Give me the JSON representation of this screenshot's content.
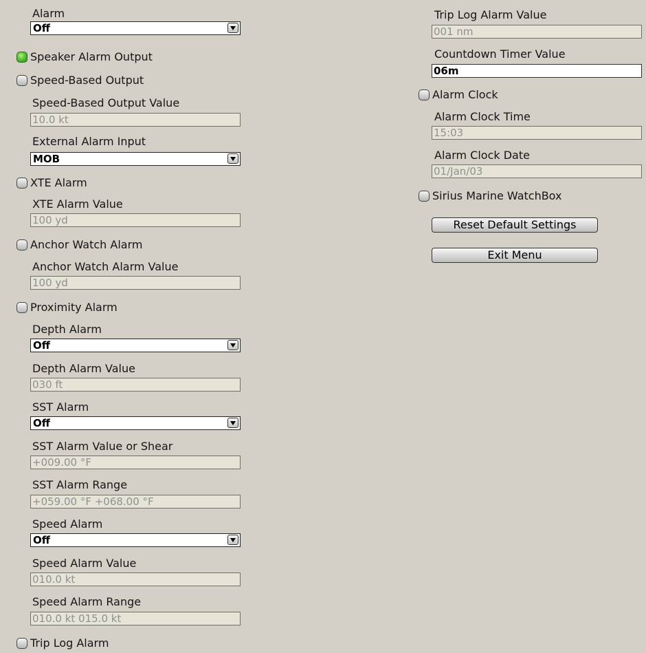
{
  "left": {
    "alarm": {
      "label": "Alarm",
      "value": "Off"
    },
    "speaker_alarm_output": {
      "label": "Speaker Alarm Output",
      "checked": true
    },
    "speed_based_output": {
      "label": "Speed-Based Output",
      "checked": false
    },
    "speed_based_output_value": {
      "label": "Speed-Based Output Value",
      "value": "10.0 kt"
    },
    "external_alarm_input": {
      "label": "External Alarm Input",
      "value": "MOB"
    },
    "xte_alarm": {
      "label": "XTE Alarm",
      "checked": false
    },
    "xte_alarm_value": {
      "label": "XTE Alarm Value",
      "value": "100 yd"
    },
    "anchor_watch_alarm": {
      "label": "Anchor Watch Alarm",
      "checked": false
    },
    "anchor_watch_alarm_value": {
      "label": "Anchor Watch Alarm Value",
      "value": "100 yd"
    },
    "proximity_alarm": {
      "label": "Proximity Alarm",
      "checked": false
    },
    "depth_alarm": {
      "label": "Depth Alarm",
      "value": "Off"
    },
    "depth_alarm_value": {
      "label": "Depth Alarm Value",
      "value": "030 ft"
    },
    "sst_alarm": {
      "label": "SST Alarm",
      "value": "Off"
    },
    "sst_alarm_value": {
      "label": "SST Alarm Value or Shear",
      "value": "+009.00 °F"
    },
    "sst_alarm_range": {
      "label": "SST Alarm Range",
      "value": "+059.00 °F +068.00 °F"
    },
    "speed_alarm": {
      "label": "Speed Alarm",
      "value": "Off"
    },
    "speed_alarm_value": {
      "label": "Speed Alarm Value",
      "value": "010.0 kt"
    },
    "speed_alarm_range": {
      "label": "Speed Alarm Range",
      "value": "010.0 kt 015.0 kt"
    },
    "trip_log_alarm": {
      "label": "Trip Log Alarm",
      "checked": false
    }
  },
  "right": {
    "trip_log_alarm_value": {
      "label": "Trip Log Alarm Value",
      "value": "001 nm"
    },
    "countdown_timer_value": {
      "label": "Countdown Timer Value",
      "value": "06m"
    },
    "alarm_clock": {
      "label": "Alarm Clock",
      "checked": false
    },
    "alarm_clock_time": {
      "label": "Alarm Clock Time",
      "value": "15:03"
    },
    "alarm_clock_date": {
      "label": "Alarm Clock Date",
      "value": "01/Jan/03"
    },
    "sirius_marine_watchbox": {
      "label": "Sirius Marine WatchBox",
      "checked": false
    },
    "reset_button": "Reset Default Settings",
    "exit_button": "Exit Menu"
  },
  "colors": {
    "background": "#d4d0c8",
    "checked_indicator": "#5cc43a",
    "readonly_field": "#e6e3d7"
  }
}
